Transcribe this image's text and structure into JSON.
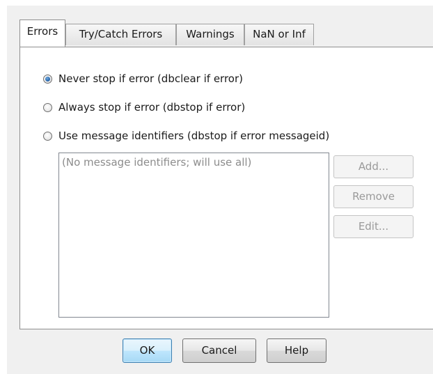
{
  "tabs": [
    {
      "label": "Errors",
      "active": true
    },
    {
      "label": "Try/Catch Errors",
      "active": false
    },
    {
      "label": "Warnings",
      "active": false
    },
    {
      "label": "NaN or Inf",
      "active": false
    }
  ],
  "options": {
    "never_stop": {
      "label": "Never stop if error (dbclear if error)",
      "checked": true
    },
    "always_stop": {
      "label": "Always stop if error (dbstop if error)",
      "checked": false
    },
    "use_ids": {
      "label": "Use message identifiers (dbstop if error messageid)",
      "checked": false
    }
  },
  "identifiers_list": {
    "placeholder": "(No message identifiers; will use all)",
    "items": []
  },
  "side_buttons": {
    "add": "Add...",
    "remove": "Remove",
    "edit": "Edit..."
  },
  "footer": {
    "ok": "OK",
    "cancel": "Cancel",
    "help": "Help"
  }
}
